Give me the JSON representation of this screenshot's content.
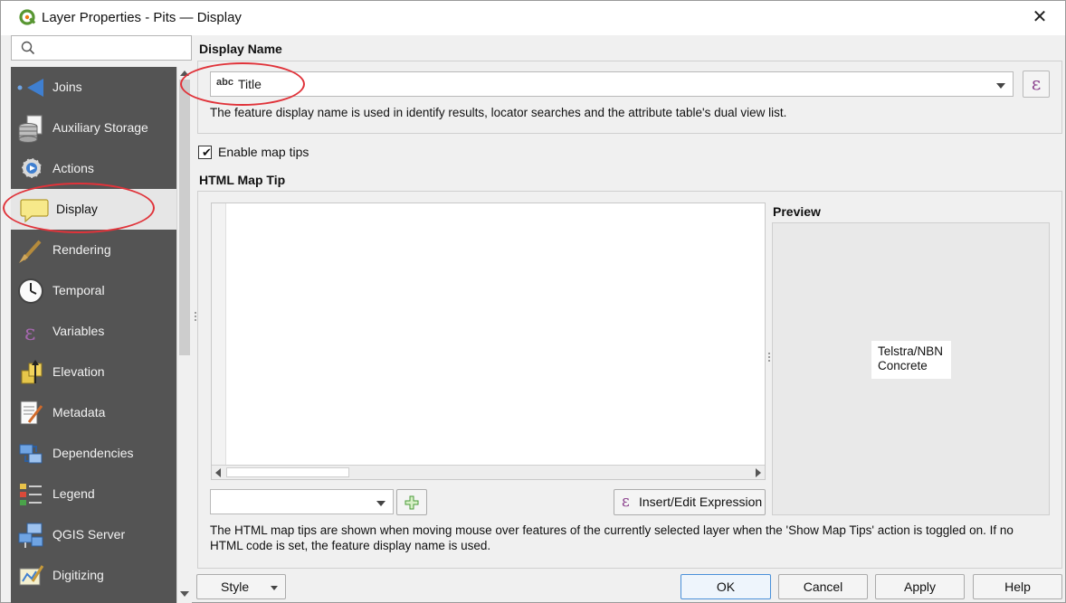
{
  "window": {
    "title": "Layer Properties - Pits — Display",
    "close_glyph": "✕"
  },
  "search": {
    "placeholder": "",
    "icon": "search-icon"
  },
  "sidebar": {
    "items": [
      {
        "label": "Joins",
        "icon": "joins-icon"
      },
      {
        "label": "Auxiliary Storage",
        "icon": "auxiliary-storage-icon"
      },
      {
        "label": "Actions",
        "icon": "actions-icon"
      },
      {
        "label": "Display",
        "icon": "display-icon",
        "active": true
      },
      {
        "label": "Rendering",
        "icon": "rendering-icon"
      },
      {
        "label": "Temporal",
        "icon": "temporal-icon"
      },
      {
        "label": "Variables",
        "icon": "variables-icon"
      },
      {
        "label": "Elevation",
        "icon": "elevation-icon"
      },
      {
        "label": "Metadata",
        "icon": "metadata-icon"
      },
      {
        "label": "Dependencies",
        "icon": "dependencies-icon"
      },
      {
        "label": "Legend",
        "icon": "legend-icon"
      },
      {
        "label": "QGIS Server",
        "icon": "qgis-server-icon"
      },
      {
        "label": "Digitizing",
        "icon": "digitizing-icon"
      }
    ]
  },
  "display_name": {
    "section_title": "Display Name",
    "field_prefix": "abc",
    "field_value": "Title",
    "expression_glyph": "ε",
    "hint": "The feature display name is used in identify results, locator searches and the attribute table's dual view list."
  },
  "map_tips": {
    "enable_label": "Enable map tips",
    "enabled": true,
    "section_title": "HTML Map Tip",
    "preview_title": "Preview",
    "preview_lines": [
      "Telstra/NBN",
      "Concrete"
    ],
    "insert_expression_label": "Insert/Edit Expression",
    "expression_glyph": "ε",
    "hint_line1": "The HTML map tips are shown when moving mouse over features of the currently selected layer when the 'Show Map Tips' action is toggled on. If no",
    "hint_line2": "HTML code is set, the feature display name is used."
  },
  "footer": {
    "style_label": "Style",
    "ok_label": "OK",
    "cancel_label": "Cancel",
    "apply_label": "Apply",
    "help_label": "Help"
  },
  "colors": {
    "sidebar_bg": "#545454",
    "highlight": "#e0333a",
    "expression": "#8a3f8c",
    "qgis_green": "#589632"
  }
}
